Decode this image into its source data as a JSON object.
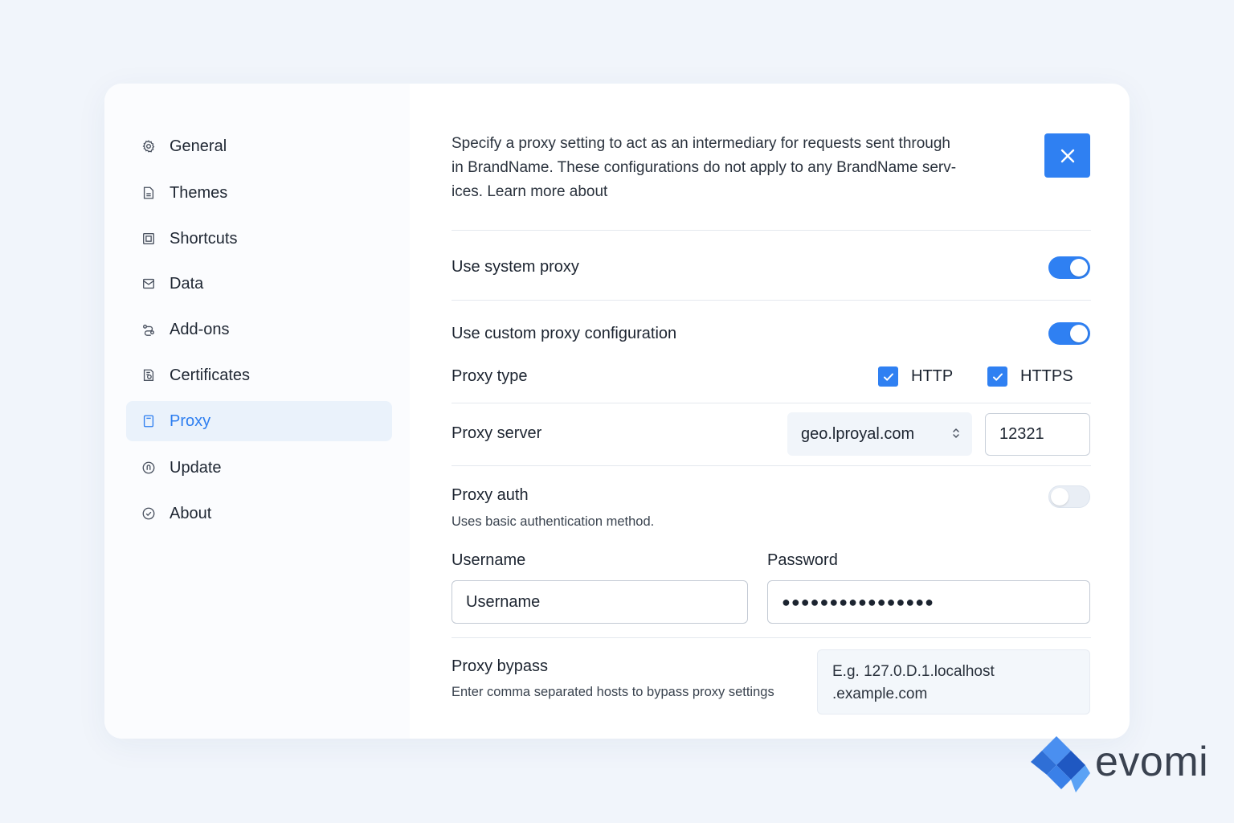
{
  "sidebar": {
    "items": [
      {
        "label": "General",
        "icon": "gear-icon"
      },
      {
        "label": "Themes",
        "icon": "document-icon"
      },
      {
        "label": "Shortcuts",
        "icon": "square-icon"
      },
      {
        "label": "Data",
        "icon": "inbox-icon"
      },
      {
        "label": "Add-ons",
        "icon": "link-icon"
      },
      {
        "label": "Certificates",
        "icon": "certificate-icon"
      },
      {
        "label": "Proxy",
        "icon": "proxy-icon",
        "active": true
      },
      {
        "label": "Update",
        "icon": "update-icon"
      },
      {
        "label": "About",
        "icon": "check-circle-icon"
      }
    ]
  },
  "main": {
    "description_line1": "Specify a proxy setting to act as an intermediary for requests sent through",
    "description_line2": "in BrandName. These configurations do not apply to any BrandName serv-",
    "description_line3": "ices. Learn more about",
    "system_proxy": {
      "label": "Use system proxy",
      "enabled": true
    },
    "custom_proxy": {
      "label": "Use custom proxy configuration",
      "enabled": true
    },
    "proxy_type": {
      "label": "Proxy type",
      "http_label": "HTTP",
      "https_label": "HTTPS",
      "http_checked": true,
      "https_checked": true
    },
    "proxy_server": {
      "label": "Proxy server",
      "host": "geo.lproyal.com",
      "port": "12321"
    },
    "proxy_auth": {
      "label": "Proxy auth",
      "description": "Uses basic authentication method.",
      "enabled": false
    },
    "username": {
      "label": "Username",
      "value": "Username"
    },
    "password": {
      "label": "Password",
      "value": "●●●●●●●●●●●●●●●●"
    },
    "proxy_bypass": {
      "label": "Proxy bypass",
      "description": "Enter comma separated hosts to bypass proxy settings",
      "placeholder_line1": "E.g. 127.0.D.1.localhost",
      "placeholder_line2": ".example.com"
    }
  },
  "brand": {
    "name": "evomi"
  },
  "colors": {
    "accent": "#2f80f2",
    "background": "#f1f5fb",
    "active_bg": "#eaf2fb"
  }
}
